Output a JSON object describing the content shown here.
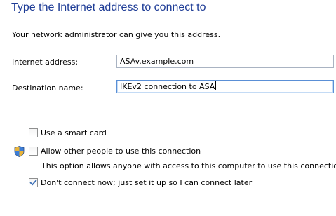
{
  "heading": "Type the Internet address to connect to",
  "intro": "Your network administrator can give you this address.",
  "internet_address": {
    "label": "Internet address:",
    "value": "ASAv.example.com"
  },
  "destination_name": {
    "label": "Destination name:",
    "value": "IKEv2 connection to ASA"
  },
  "smart_card": {
    "label": "Use a smart card",
    "checked": false
  },
  "allow_others": {
    "label": "Allow other people to use this connection",
    "description": "This option allows anyone with access to this computer to use this connection.",
    "checked": false,
    "icon": "uac-shield-icon"
  },
  "dont_connect": {
    "label": "Don't connect now; just set it up so I can connect later",
    "checked": true
  },
  "colors": {
    "heading": "#1e3c96",
    "input_border": "#a9b3c2",
    "focus_border": "#5a8fd6",
    "checkmark": "#3b6fb6"
  }
}
